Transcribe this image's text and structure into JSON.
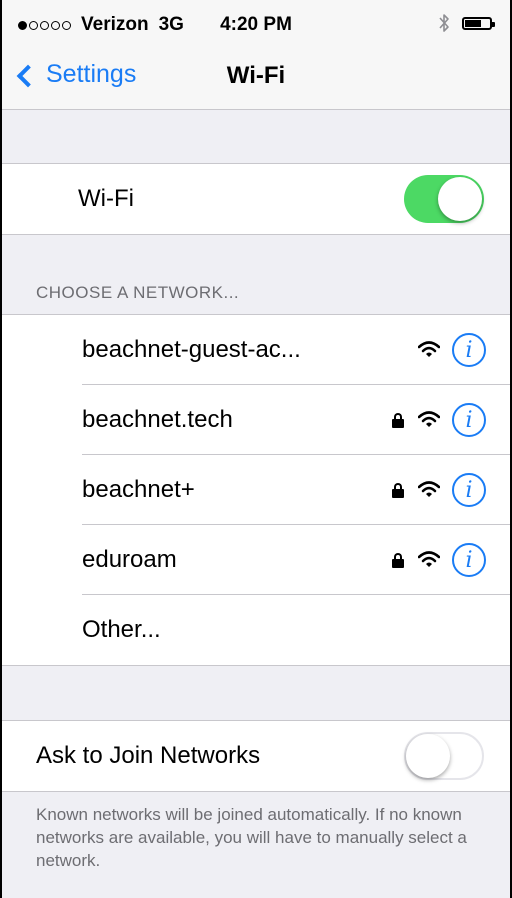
{
  "status_bar": {
    "signal_dots": [
      true,
      false,
      false,
      false,
      false
    ],
    "carrier": "Verizon",
    "network_type": "3G",
    "time": "4:20 PM",
    "bluetooth_icon": "bluetooth-icon",
    "battery_level": 0.6
  },
  "navbar": {
    "back_label": "Settings",
    "title": "Wi-Fi"
  },
  "wifi_toggle": {
    "label": "Wi-Fi",
    "on": true
  },
  "networks_section": {
    "header": "CHOOSE A NETWORK...",
    "items": [
      {
        "name": "beachnet-guest-ac...",
        "locked": false
      },
      {
        "name": "beachnet.tech",
        "locked": true
      },
      {
        "name": "beachnet+",
        "locked": true
      },
      {
        "name": "eduroam",
        "locked": true
      }
    ],
    "other_label": "Other..."
  },
  "ask_to_join": {
    "label": "Ask to Join Networks",
    "on": false,
    "footer": "Known networks will be joined automatically. If no known networks are available, you will have to manually select a network."
  },
  "colors": {
    "accent": "#1a7cf5",
    "toggle_on": "#4cd964",
    "group_background": "#efeff4"
  },
  "icons": {
    "wifi": "wifi-signal-icon",
    "lock": "lock-icon",
    "info": "info-icon",
    "back": "chevron-left-icon"
  }
}
